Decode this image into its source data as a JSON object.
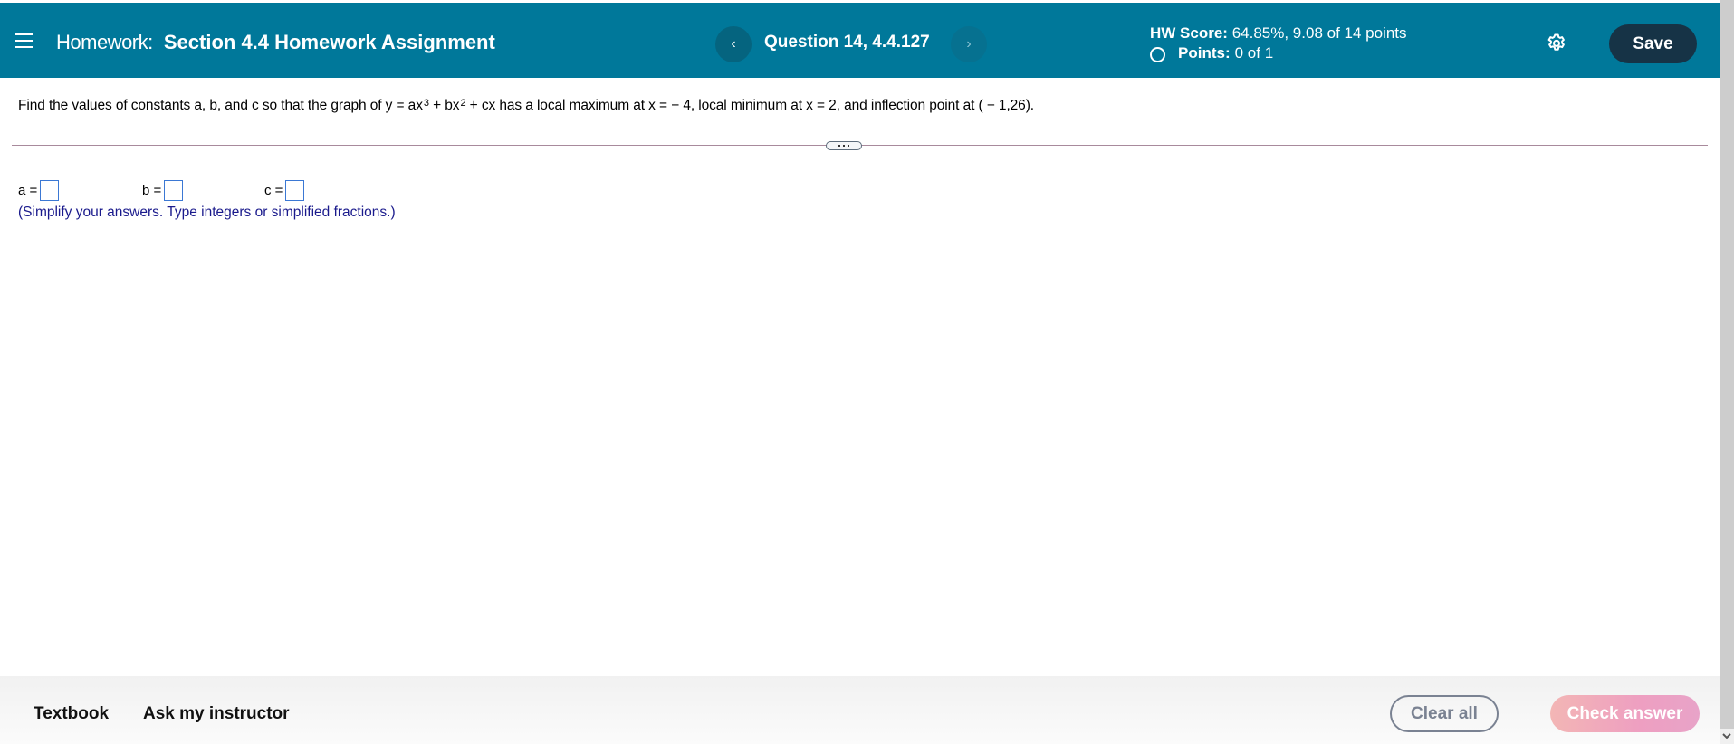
{
  "header": {
    "menu_icon": "hamburger-menu-icon",
    "homework_prefix": "Homework:",
    "homework_name": "Section 4.4 Homework Assignment",
    "prev_icon": "‹",
    "next_icon": "›",
    "question_label": "Question 14, 4.4.127",
    "hw_score_label": "HW Score:",
    "hw_score_value": "64.85%, 9.08 of 14 points",
    "points_label": "Points:",
    "points_value": "0 of 1",
    "settings_icon": "gear-icon",
    "save_label": "Save"
  },
  "question": {
    "text_part1": "Find the values of constants a, b, and c so that the graph of y = ax",
    "exp1": "3",
    "text_part2": " + bx",
    "exp2": "2",
    "text_part3": " + cx has a local maximum at x =  − 4, local minimum at x = 2, and inflection point at ( − 1,26)."
  },
  "answers": {
    "a_label": "a =",
    "a_value": "",
    "b_label": "b =",
    "b_value": "",
    "c_label": "c =",
    "c_value": "",
    "hint": "(Simplify your answers. Type integers or simplified fractions.)"
  },
  "footer": {
    "textbook_label": "Textbook",
    "ask_label": "Ask my instructor",
    "clear_label": "Clear all",
    "check_label": "Check answer"
  },
  "colors": {
    "header_bg": "#00789a",
    "save_bg": "#163346",
    "hint_text": "#1a1a8c",
    "check_answer_bg": "#ee9fc1",
    "input_border": "#3b78d4"
  }
}
